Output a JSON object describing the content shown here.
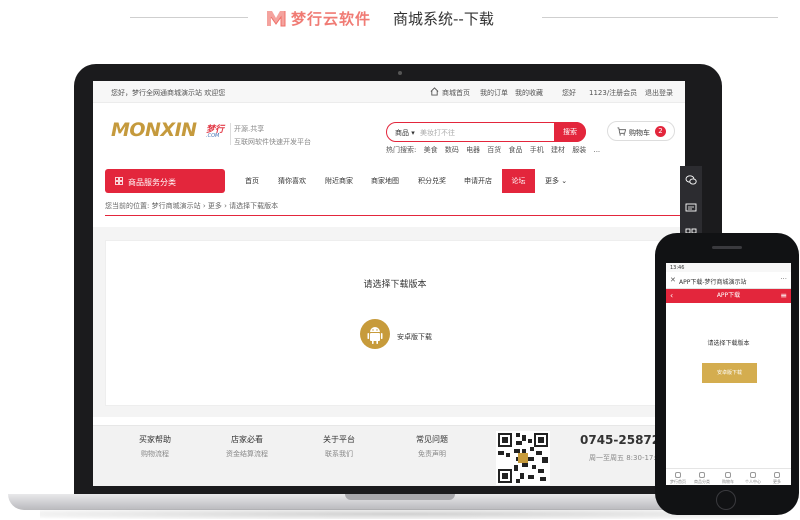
{
  "banner": {
    "brand": "梦行云软件",
    "subtitle": "商城系统--下载"
  },
  "topbar": {
    "welcome": "您好，梦行全网通商城演示站 欢迎您",
    "links": [
      "商城首页",
      "我的订单",
      "我的收藏",
      "您好",
      "1123/注册会员",
      "退出登录"
    ]
  },
  "logo": {
    "brand": "MONXIN",
    "cn": "梦行",
    "com": ".COM",
    "slogan1": "开源.共享",
    "slogan2": "互联网软件快速开发平台"
  },
  "search": {
    "category": "商品",
    "placeholder": "美妆打不往",
    "button": "搜索",
    "hot_label": "热门搜索:",
    "hot": [
      "美食",
      "数码",
      "电器",
      "百货",
      "食品",
      "手机",
      "建材",
      "服装",
      "..."
    ]
  },
  "cart": {
    "label": "购物车",
    "count": "2"
  },
  "nav": {
    "category_button": "商品服务分类",
    "items": [
      "首页",
      "猜你喜欢",
      "附近商家",
      "商家地图",
      "积分兑奖",
      "申请开店",
      "论坛",
      "更多 ⌄"
    ],
    "active_index": 6
  },
  "breadcrumb": {
    "label": "您当前的位置:",
    "items": [
      "梦行商城演示站",
      "更多",
      "请选择下载版本"
    ],
    "sep": "›"
  },
  "main": {
    "title": "请选择下载版本",
    "android_label": "安卓版下载"
  },
  "footer": {
    "columns": [
      {
        "heading": "买家帮助",
        "item": "购物流程"
      },
      {
        "heading": "店家必看",
        "item": "资金结算流程"
      },
      {
        "heading": "关于平台",
        "item": "联系我们"
      },
      {
        "heading": "常见问题",
        "item": "免责声明"
      }
    ],
    "phone": "0745-2587295",
    "hours": "周一至周五 8:30-17:30"
  },
  "mobile": {
    "status_time": "13:46",
    "page_title": "APP下载-梦行商城演示站",
    "header": "APP下载",
    "message": "请选择下载版本",
    "button": "安卓版下载",
    "nav_items": [
      "梦行首页",
      "商品分类",
      "购物车",
      "个人中心",
      "更多"
    ]
  },
  "colors": {
    "accent": "#e3263c",
    "gold": "#c79b3b",
    "brand_pink": "#f07b74"
  }
}
